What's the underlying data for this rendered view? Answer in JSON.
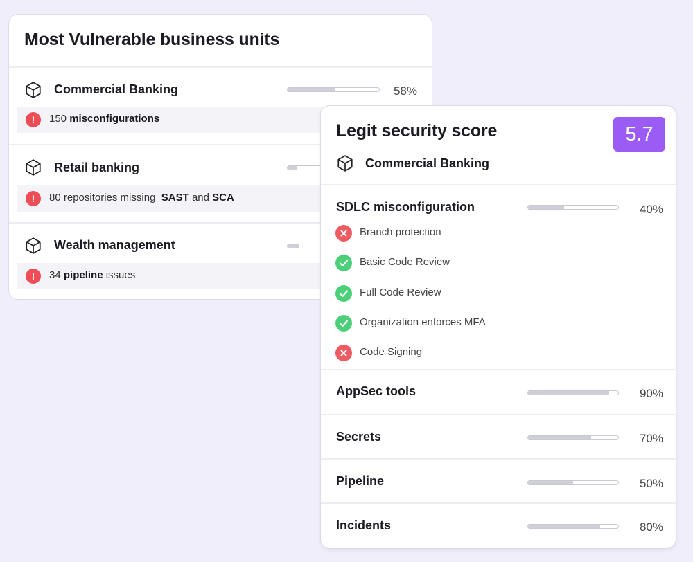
{
  "vulnerable_units": {
    "title": "Most Vulnerable business units",
    "units": [
      {
        "name": "Commercial Banking",
        "percent": "58%",
        "fill": 0.52,
        "issue_count": "150",
        "issue_bold": "misconfigurations"
      },
      {
        "name": "Retail banking",
        "fill": 0.1,
        "issue_count": "80",
        "issue_pre": "repositories missing",
        "issue_bold1": "SAST",
        "issue_mid": "and",
        "issue_bold2": "SCA"
      },
      {
        "name": "Wealth management",
        "fill": 0.12,
        "issue_count": "34",
        "issue_bold": "pipeline",
        "issue_post": "issues"
      }
    ]
  },
  "security_score": {
    "title": "Legit security score",
    "score": "5.7",
    "unit": "Commercial Banking",
    "sdlc": {
      "title": "SDLC misconfiguration",
      "percent": "40%",
      "fill": 0.4,
      "checks": [
        {
          "label": "Branch protection",
          "status": "fail"
        },
        {
          "label": "Basic Code Review",
          "status": "pass"
        },
        {
          "label": "Full Code Review",
          "status": "pass"
        },
        {
          "label": "Organization enforces MFA",
          "status": "pass"
        },
        {
          "label": "Code Signing",
          "status": "fail"
        }
      ]
    },
    "categories": [
      {
        "name": "AppSec tools",
        "percent": "90%",
        "fill": 0.9
      },
      {
        "name": "Secrets",
        "percent": "70%",
        "fill": 0.7
      },
      {
        "name": "Pipeline",
        "percent": "50%",
        "fill": 0.5
      },
      {
        "name": "Incidents",
        "percent": "80%",
        "fill": 0.8
      }
    ]
  },
  "colors": {
    "background": "#efeefa",
    "accent_score": "#9b5cf6",
    "alert": "#ef4d56",
    "pass": "#4ccf79",
    "fail": "#ef5a63"
  }
}
